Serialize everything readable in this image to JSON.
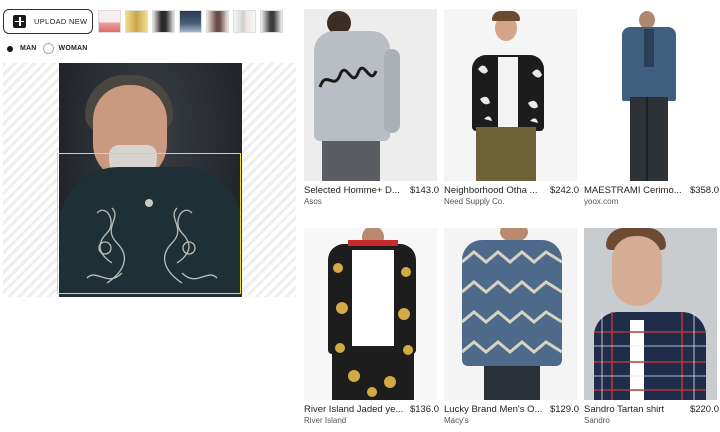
{
  "upload": {
    "label": "UPLOAD NEW"
  },
  "thumbnails": [
    {
      "icon": "thumbnail-1",
      "color": "#f4e9e9",
      "accent": "#e26a6a"
    },
    {
      "icon": "thumbnail-2",
      "color": "#e9d47a",
      "accent": "#c9a54a"
    },
    {
      "icon": "thumbnail-3",
      "color": "#d9d9d9",
      "accent": "#2b2b2b"
    },
    {
      "icon": "thumbnail-4",
      "color": "#2c3a4f",
      "accent": "#a9b6c9"
    },
    {
      "icon": "thumbnail-5",
      "color": "#efe3e3",
      "accent": "#6b4a4a"
    },
    {
      "icon": "thumbnail-6",
      "color": "#f2f2f2",
      "accent": "#c7c7c7"
    },
    {
      "icon": "thumbnail-7",
      "color": "#f0f0f0",
      "accent": "#3b3b3b"
    }
  ],
  "gender": {
    "man_label": "MAN",
    "woman_label": "WOMAN",
    "selected": "MAN"
  },
  "products": [
    {
      "name": "Selected Homme+ D...",
      "price": "$143.0",
      "store": "Asos"
    },
    {
      "name": "Neighborhood Otha ...",
      "price": "$242.0",
      "store": "Need Supply Co."
    },
    {
      "name": "MAESTRAMI Cerimo...",
      "price": "$358.0",
      "store": "yoox.com"
    },
    {
      "name": "River Island Jaded ye...",
      "price": "$136.0",
      "store": "River Island"
    },
    {
      "name": "Lucky Brand Men's O...",
      "price": "$129.0",
      "store": "Macy's"
    },
    {
      "name": "Sandro Tartan shirt",
      "price": "$220.0",
      "store": "Sandro"
    }
  ],
  "colors": {
    "face_box": "#f2e200",
    "accent": "#111111"
  }
}
